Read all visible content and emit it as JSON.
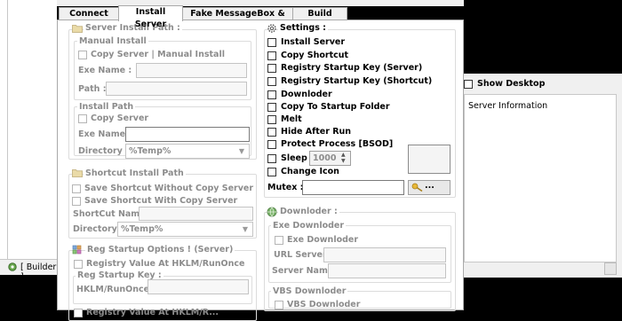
{
  "tabs": [
    {
      "label": "Connect Info"
    },
    {
      "label": "Install Server"
    },
    {
      "label": "Fake MessageBox & Antis"
    },
    {
      "label": "Build Server"
    }
  ],
  "left": {
    "server_install_path": {
      "title": "Server Install Path :",
      "manual_install": {
        "title": "Manual Install",
        "copy_label": "Copy Server | Manual Install",
        "exe_name_label": "Exe Name :",
        "path_label": "Path :"
      },
      "install_path": {
        "title": "Install Path",
        "copy_label": "Copy Server",
        "exe_name_label": "Exe Name :",
        "directory_label": "Directory :",
        "directory_value": "%Temp%"
      }
    },
    "shortcut": {
      "title": "Shortcut Install Path",
      "save_without": "Save Shortcut Without Copy Server",
      "save_with": "Save Shortcut With Copy Server",
      "name_label": "ShortCut Name :",
      "directory_label": "Directory :",
      "directory_value": "%Temp%"
    },
    "reg": {
      "title": "Reg Startup Options ! (Server)",
      "hklm_runonce": "Registry Value At HKLM/RunOnce",
      "key_title": "Reg Startup Key :",
      "key_label": "HKLM/RunOnce :",
      "next_partial": "Registry Value At HKLM/R..."
    }
  },
  "settings": {
    "title": "Settings :",
    "items": [
      {
        "label": "Install Server"
      },
      {
        "label": "Copy Shortcut"
      },
      {
        "label": "Registry Startup Key (Server)"
      },
      {
        "label": "Registry Startup Key (Shortcut)"
      },
      {
        "label": "Downloder"
      },
      {
        "label": "Copy To Startup Folder"
      },
      {
        "label": "Melt"
      },
      {
        "label": "Hide After Run"
      },
      {
        "label": "Protect Process [BSOD]"
      }
    ],
    "sleep_label": "Sleep :",
    "sleep_value": "1000",
    "change_icon": "Change Icon",
    "mutex_label": "Mutex :",
    "mutex_button": "..."
  },
  "downloder": {
    "title": "Downloder :",
    "exe": {
      "title": "Exe Downloder",
      "check_label": "Exe Downloder",
      "url_label": "URL Server :",
      "name_label": "Server Name :"
    },
    "vbs": {
      "title": "VBS Downloder",
      "check_label": "VBS Downloder"
    }
  },
  "right": {
    "show_desktop": "Show Desktop",
    "server_info": "Server Information"
  },
  "builder": {
    "label": "[ Builder ]"
  }
}
